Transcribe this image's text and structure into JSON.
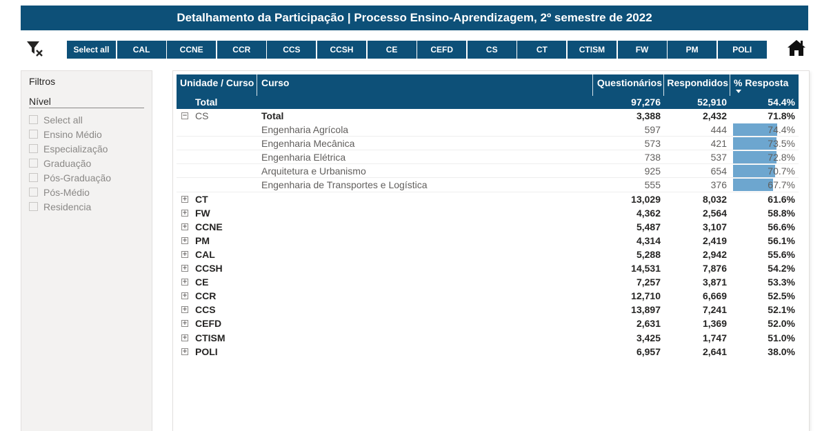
{
  "title": "Detalhamento da Participação | Processo Ensino-Aprendizagem, 2º semestre de 2022",
  "icons": {
    "clear_filter": "filter-clear-icon",
    "home": "home-icon"
  },
  "slicer": {
    "buttons": [
      "Select all",
      "CAL",
      "CCNE",
      "CCR",
      "CCS",
      "CCSH",
      "CE",
      "CEFD",
      "CS",
      "CT",
      "CTISM",
      "FW",
      "PM",
      "POLI"
    ]
  },
  "filters": {
    "title": "Filtros",
    "group": "Nível",
    "options": [
      "Select all",
      "Ensino Médio",
      "Especialização",
      "Graduação",
      "Pós-Graduação",
      "Pós-Médio",
      "Residencia"
    ]
  },
  "matrix": {
    "headers": {
      "unit": "Unidade / Curso",
      "curso": "Curso",
      "q": "Questionários",
      "r": "Respondidos",
      "p": "% Resposta"
    },
    "total": {
      "label": "Total",
      "q": "97,276",
      "r": "52,910",
      "p": "54.4%"
    },
    "expanded": {
      "unit": "CS",
      "label": "Total",
      "q": "3,388",
      "r": "2,432",
      "p": "71.8%",
      "courses": [
        {
          "name": "Engenharia Agrícola",
          "q": "597",
          "r": "444",
          "p": "74.4%",
          "pv": 74.4
        },
        {
          "name": "Engenharia Mecânica",
          "q": "573",
          "r": "421",
          "p": "73.5%",
          "pv": 73.5
        },
        {
          "name": "Engenharia Elétrica",
          "q": "738",
          "r": "537",
          "p": "72.8%",
          "pv": 72.8
        },
        {
          "name": "Arquitetura e Urbanismo",
          "q": "925",
          "r": "654",
          "p": "70.7%",
          "pv": 70.7
        },
        {
          "name": "Engenharia de Transportes e Logística",
          "q": "555",
          "r": "376",
          "p": "67.7%",
          "pv": 67.7
        }
      ]
    },
    "units": [
      {
        "name": "CT",
        "q": "13,029",
        "r": "8,032",
        "p": "61.6%"
      },
      {
        "name": "FW",
        "q": "4,362",
        "r": "2,564",
        "p": "58.8%"
      },
      {
        "name": "CCNE",
        "q": "5,487",
        "r": "3,107",
        "p": "56.6%"
      },
      {
        "name": "PM",
        "q": "4,314",
        "r": "2,419",
        "p": "56.1%"
      },
      {
        "name": "CAL",
        "q": "5,288",
        "r": "2,942",
        "p": "55.6%"
      },
      {
        "name": "CCSH",
        "q": "14,531",
        "r": "7,876",
        "p": "54.2%"
      },
      {
        "name": "CE",
        "q": "7,257",
        "r": "3,871",
        "p": "53.3%"
      },
      {
        "name": "CCR",
        "q": "12,710",
        "r": "6,669",
        "p": "52.5%"
      },
      {
        "name": "CCS",
        "q": "13,897",
        "r": "7,241",
        "p": "52.1%"
      },
      {
        "name": "CEFD",
        "q": "2,631",
        "r": "1,369",
        "p": "52.0%"
      },
      {
        "name": "CTISM",
        "q": "3,425",
        "r": "1,747",
        "p": "51.0%"
      },
      {
        "name": "POLI",
        "q": "6,957",
        "r": "2,641",
        "p": "38.0%"
      }
    ]
  }
}
